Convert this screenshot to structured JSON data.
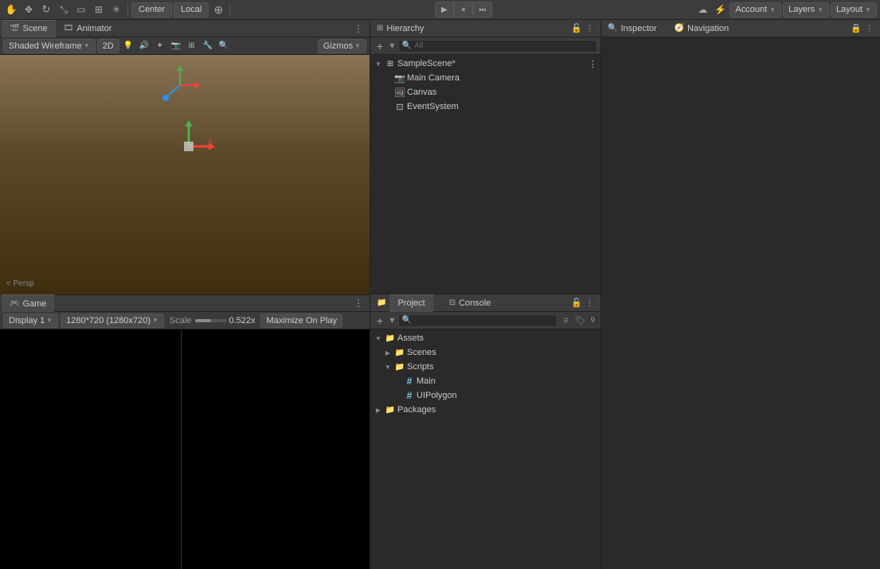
{
  "topbar": {
    "tools": [
      {
        "name": "hand-tool-icon",
        "symbol": "✋"
      },
      {
        "name": "move-tool-icon",
        "symbol": "✥"
      },
      {
        "name": "rotate-tool-icon",
        "symbol": "↻"
      },
      {
        "name": "scale-tool-icon",
        "symbol": "⤡"
      },
      {
        "name": "rect-tool-icon",
        "symbol": "▭"
      },
      {
        "name": "transform-tool-icon",
        "symbol": "⊞"
      },
      {
        "name": "custom-tool-icon",
        "symbol": "✳"
      }
    ],
    "center_btn": "Center",
    "local_btn": "Local",
    "pivot_btn": "⊕",
    "account_label": "Account",
    "layers_label": "Layers",
    "layout_label": "Layout"
  },
  "play_controls": {
    "play_symbol": "▶",
    "pause_symbol": "⏸",
    "step_symbol": "⏭"
  },
  "scene_tab": {
    "label": "Scene",
    "icon": "🎬"
  },
  "animator_tab": {
    "label": "Animator",
    "icon": "🎞"
  },
  "scene_toolbar": {
    "shading_label": "Shaded Wireframe",
    "mode_label": "2D",
    "gizmos_label": "Gizmos",
    "persp_label": "< Persp"
  },
  "game_tab": {
    "label": "Game",
    "icon": "🎮"
  },
  "game_toolbar": {
    "display_label": "Display 1",
    "resolution_label": "1280*720 (1280x720)",
    "scale_label": "Scale",
    "scale_value": "0.522x",
    "maximize_label": "Maximize On Play"
  },
  "hierarchy": {
    "title": "Hierarchy",
    "items": [
      {
        "id": "sample-scene",
        "label": "SampleScene*",
        "indent": 0,
        "icon": "⊞",
        "arrow": "▼",
        "has_arrow": true
      },
      {
        "id": "main-camera",
        "label": "Main Camera",
        "indent": 1,
        "icon": "📷",
        "arrow": "",
        "has_arrow": false
      },
      {
        "id": "canvas",
        "label": "Canvas",
        "indent": 1,
        "icon": "🖼",
        "arrow": "",
        "has_arrow": false
      },
      {
        "id": "event-system",
        "label": "EventSystem",
        "indent": 1,
        "icon": "⊡",
        "arrow": "",
        "has_arrow": false
      }
    ],
    "search_placeholder": "All"
  },
  "inspector": {
    "title": "Inspector",
    "icon": "🔍"
  },
  "navigation": {
    "title": "Navigation",
    "icon": "🧭"
  },
  "project": {
    "title": "Project",
    "console_title": "Console",
    "items": [
      {
        "id": "assets",
        "label": "Assets",
        "indent": 0,
        "icon": "📁",
        "arrow": "▼",
        "has_arrow": true
      },
      {
        "id": "scenes",
        "label": "Scenes",
        "indent": 1,
        "icon": "📁",
        "arrow": "▶",
        "has_arrow": true
      },
      {
        "id": "scripts",
        "label": "Scripts",
        "indent": 1,
        "icon": "📁",
        "arrow": "▼",
        "has_arrow": true
      },
      {
        "id": "main-script",
        "label": "Main",
        "indent": 2,
        "icon": "#",
        "arrow": "",
        "has_arrow": false
      },
      {
        "id": "uipolygon-script",
        "label": "UIPolygon",
        "indent": 2,
        "icon": "#",
        "arrow": "",
        "has_arrow": false
      },
      {
        "id": "packages",
        "label": "Packages",
        "indent": 0,
        "icon": "📁",
        "arrow": "▶",
        "has_arrow": true
      }
    ],
    "badge_count": "9"
  }
}
